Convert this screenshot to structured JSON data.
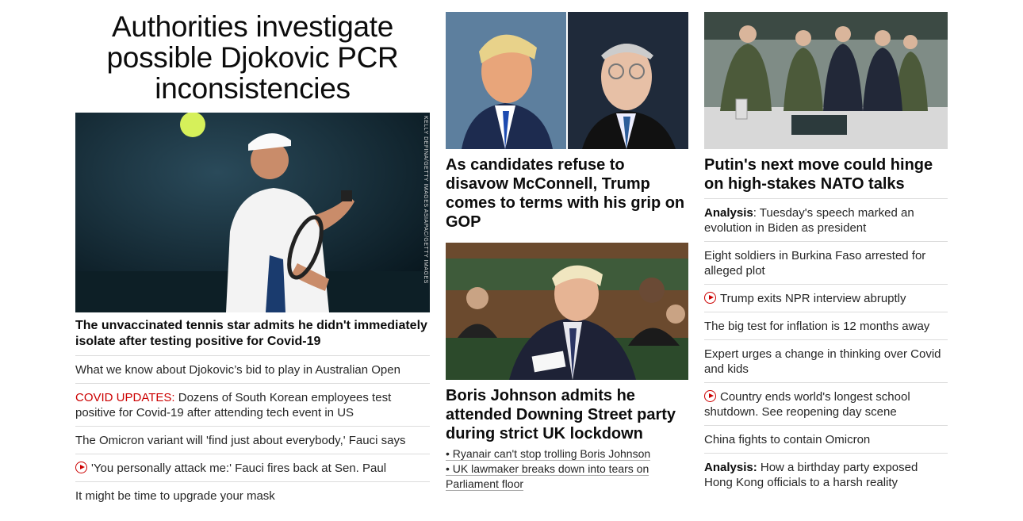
{
  "col1": {
    "headline": "Authorities investigate possible Djokovic PCR inconsistencies",
    "image_credit": "KELLY DEFINA/GETTY IMAGES ASIAPAC/GETTY IMAGES",
    "lead": "The unvaccinated tennis star admits he didn't immediately isolate after testing positive for Covid-19",
    "items": [
      {
        "text": "What we know about Djokovic’s bid to play in Australian Open"
      },
      {
        "kicker": "COVID UPDATES:",
        "text": " Dozens of South Korean employees test positive for Covid-19 after attending tech event in US"
      },
      {
        "text": "The Omicron variant will 'find just about everybody,' Fauci says"
      },
      {
        "video": true,
        "text": "'You personally attack me:' Fauci fires back at Sen. Paul"
      },
      {
        "text": "It might be time to upgrade your mask"
      }
    ]
  },
  "col2": {
    "card1_title": "As candidates refuse to disavow McConnell, Trump comes to terms with his grip on GOP",
    "card2_title": "Boris Johnson admits he attended Downing Street party during strict UK lockdown",
    "sub_links": [
      "• Ryanair can't stop trolling Boris Johnson",
      "• UK lawmaker breaks down into tears on Parliament floor"
    ]
  },
  "col3": {
    "card_title": "Putin's next move could hinge on high-stakes NATO talks",
    "items": [
      {
        "kicker": "Analysis",
        "text": ": Tuesday's speech marked an evolution in Biden as president"
      },
      {
        "text": "Eight soldiers in Burkina Faso arrested for alleged plot"
      },
      {
        "video": true,
        "text": "Trump exits NPR interview abruptly"
      },
      {
        "text": "The big test for inflation is 12 months away"
      },
      {
        "text": "Expert urges a change in thinking over Covid and kids"
      },
      {
        "video": true,
        "text": "Country ends world's longest school shutdown. See reopening day scene"
      },
      {
        "text": "China fights to contain Omicron"
      },
      {
        "kicker": "Analysis:",
        "text": " How a birthday party exposed Hong Kong officials to a harsh reality"
      }
    ]
  },
  "colors": {
    "accent_red": "#cc0000",
    "divider": "#dcdcdc",
    "text": "#262626"
  }
}
